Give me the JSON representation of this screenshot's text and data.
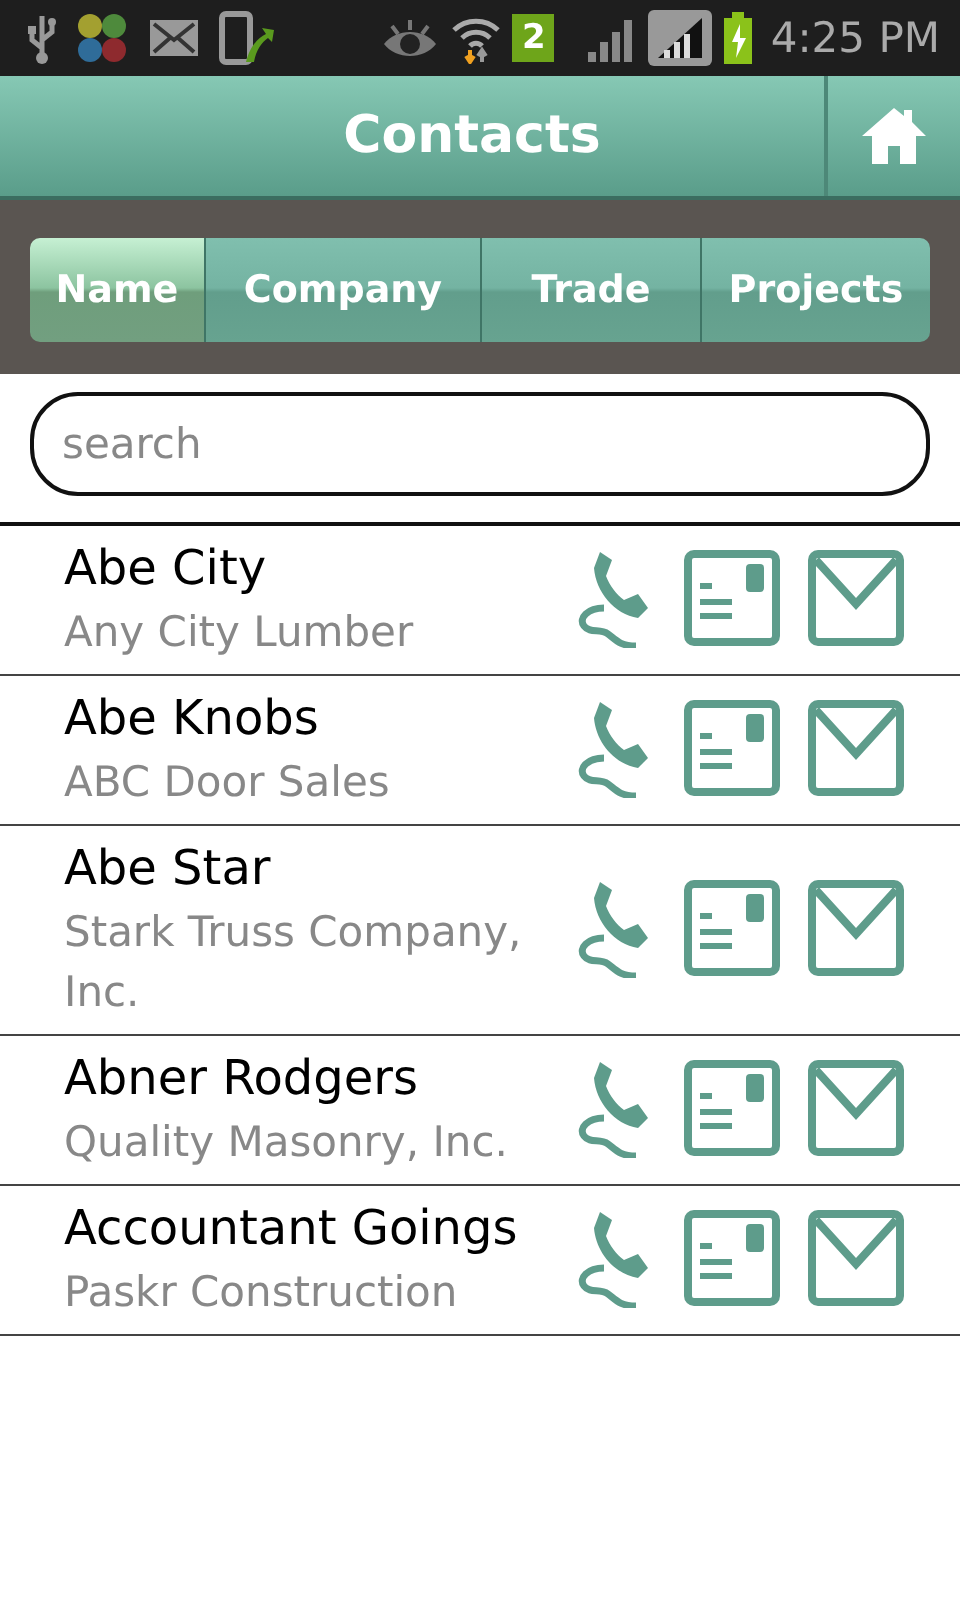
{
  "status_bar": {
    "sim_slot": "2",
    "time": "4:25 PM"
  },
  "header": {
    "title": "Contacts"
  },
  "tabs": [
    {
      "label": "Name",
      "selected": true
    },
    {
      "label": "Company",
      "selected": false
    },
    {
      "label": "Trade",
      "selected": false
    },
    {
      "label": "Projects",
      "selected": false
    }
  ],
  "search": {
    "placeholder": "search"
  },
  "contacts": [
    {
      "name": "Abe City",
      "company": "Any City Lumber"
    },
    {
      "name": "Abe Knobs",
      "company": "ABC Door Sales"
    },
    {
      "name": "Abe Star",
      "company": "Stark Truss Company, Inc."
    },
    {
      "name": "Abner Rodgers",
      "company": "Quality Masonry, Inc."
    },
    {
      "name": "Accountant Goings",
      "company": "Paskr Construction"
    }
  ]
}
